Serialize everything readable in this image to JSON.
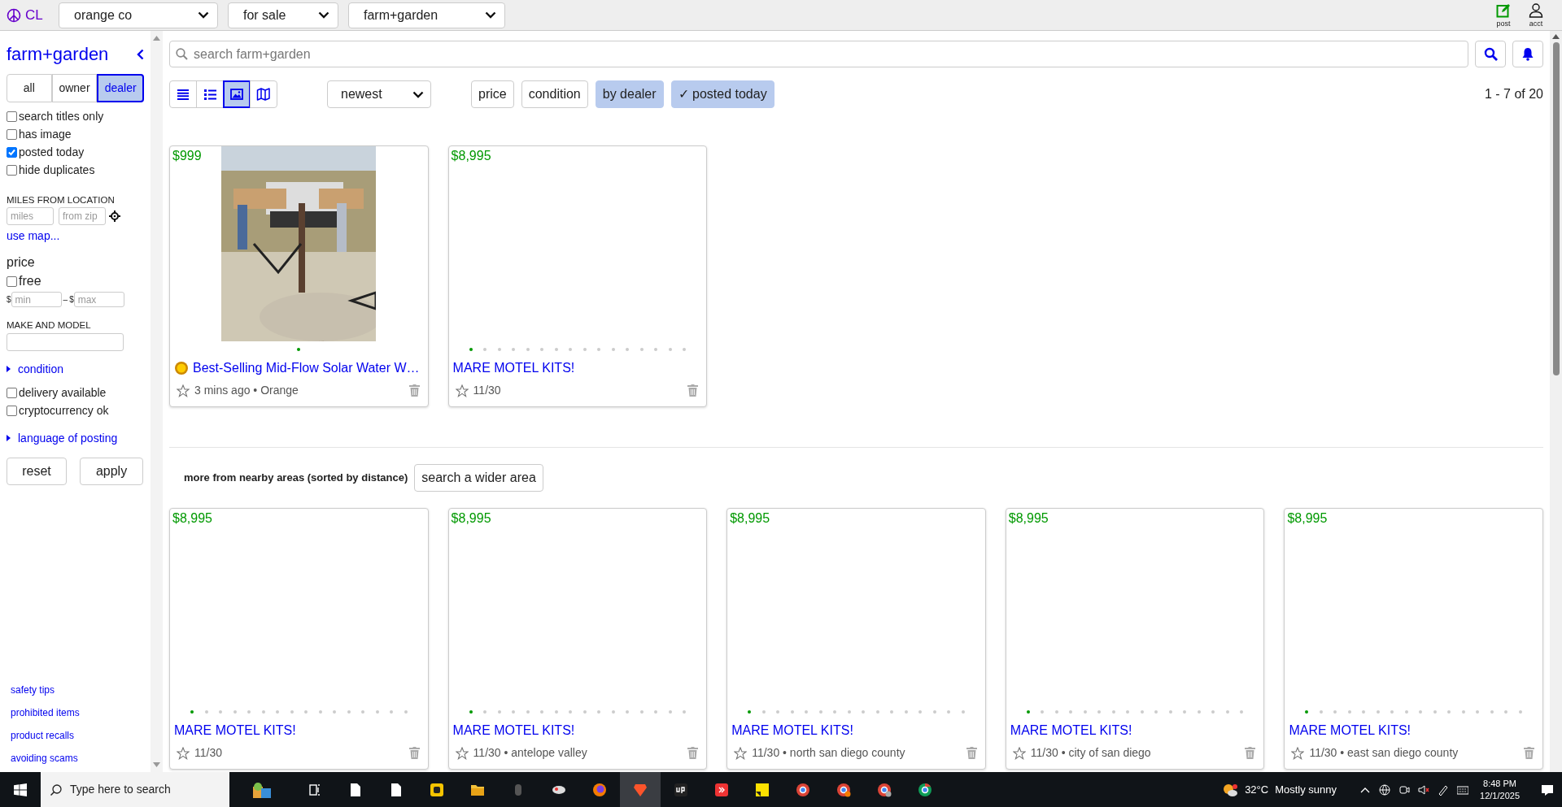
{
  "top_bar": {
    "logo": "CL",
    "selects": [
      "orange co",
      "for sale",
      "farm+garden"
    ],
    "actions": [
      {
        "kind": "post",
        "label": "post"
      },
      {
        "kind": "account",
        "label": "acct"
      }
    ]
  },
  "sidebar": {
    "title": "farm+garden",
    "seller_tabs": [
      {
        "label": "all",
        "selected": false
      },
      {
        "label": "owner",
        "selected": false
      },
      {
        "label": "dealer",
        "selected": true
      }
    ],
    "options": [
      {
        "label": "search titles only",
        "checked": false
      },
      {
        "label": "has image",
        "checked": false
      },
      {
        "label": "posted today",
        "checked": true
      },
      {
        "label": "hide duplicates",
        "checked": false
      }
    ],
    "location": {
      "heading": "MILES FROM LOCATION",
      "miles_placeholder": "miles",
      "zip_placeholder": "from zip",
      "map_link": "use map..."
    },
    "price": {
      "heading": "price",
      "free": {
        "label": "free",
        "checked": false
      },
      "min_prefix": "$",
      "min_placeholder": "min",
      "separator": "–",
      "max_prefix": "$",
      "max_placeholder": "max"
    },
    "make_model": {
      "heading": "MAKE AND MODEL"
    },
    "condition": {
      "label": "condition",
      "expanded": false
    },
    "more_options": [
      {
        "label": "delivery available",
        "checked": false
      },
      {
        "label": "cryptocurrency ok",
        "checked": false
      }
    ],
    "language": {
      "label": "language of posting",
      "expanded": false
    },
    "buttons": [
      "reset",
      "apply"
    ],
    "footer_links": [
      "safety tips",
      "prohibited items",
      "product recalls",
      "avoiding scams"
    ]
  },
  "main": {
    "search": {
      "placeholder": "search farm+garden"
    },
    "view_modes": [
      {
        "kind": "list",
        "selected": false
      },
      {
        "kind": "detail",
        "selected": false
      },
      {
        "kind": "gallery",
        "selected": true
      },
      {
        "kind": "map",
        "selected": false
      }
    ],
    "sort": "newest",
    "filters": [
      {
        "label": "price",
        "selected": false
      },
      {
        "label": "condition",
        "selected": false
      },
      {
        "label": "by dealer",
        "selected": true
      },
      {
        "label": "✓ posted today",
        "selected": true
      }
    ],
    "count": "1 - 7 of 20",
    "results": [
      {
        "price": "$999",
        "kind": "picture",
        "featured": true,
        "title": "Best-Selling Mid-Flow Solar Water W…",
        "meta": "3 mins ago • Orange",
        "photos": [
          {
            "selected": true
          }
        ]
      },
      {
        "price": "$8,995",
        "featured": false,
        "title": "MARE MOTEL KITS!",
        "meta": "11/30",
        "photos": [
          {
            "selected": true
          },
          {
            "selected": false
          },
          {
            "selected": false
          },
          {
            "selected": false
          },
          {
            "selected": false
          },
          {
            "selected": false
          },
          {
            "selected": false
          },
          {
            "selected": false
          },
          {
            "selected": false
          },
          {
            "selected": false
          },
          {
            "selected": false
          },
          {
            "selected": false
          },
          {
            "selected": false
          },
          {
            "selected": false
          },
          {
            "selected": false
          },
          {
            "selected": false
          }
        ]
      }
    ],
    "nearby": {
      "heading": "more from nearby areas (sorted by distance)",
      "button": "search a wider area",
      "results": [
        {
          "price": "$8,995",
          "featured": false,
          "title": "MARE MOTEL KITS!",
          "meta": "11/30",
          "photos": [
            {
              "selected": true
            },
            {
              "selected": false
            },
            {
              "selected": false
            },
            {
              "selected": false
            },
            {
              "selected": false
            },
            {
              "selected": false
            },
            {
              "selected": false
            },
            {
              "selected": false
            },
            {
              "selected": false
            },
            {
              "selected": false
            },
            {
              "selected": false
            },
            {
              "selected": false
            },
            {
              "selected": false
            },
            {
              "selected": false
            },
            {
              "selected": false
            },
            {
              "selected": false
            }
          ]
        },
        {
          "price": "$8,995",
          "featured": false,
          "title": "MARE MOTEL KITS!",
          "meta": "11/30 • antelope valley",
          "photos": [
            {
              "selected": true
            },
            {
              "selected": false
            },
            {
              "selected": false
            },
            {
              "selected": false
            },
            {
              "selected": false
            },
            {
              "selected": false
            },
            {
              "selected": false
            },
            {
              "selected": false
            },
            {
              "selected": false
            },
            {
              "selected": false
            },
            {
              "selected": false
            },
            {
              "selected": false
            },
            {
              "selected": false
            },
            {
              "selected": false
            },
            {
              "selected": false
            },
            {
              "selected": false
            }
          ]
        },
        {
          "price": "$8,995",
          "featured": false,
          "title": "MARE MOTEL KITS!",
          "meta": "11/30 • north san diego county",
          "photos": [
            {
              "selected": true
            },
            {
              "selected": false
            },
            {
              "selected": false
            },
            {
              "selected": false
            },
            {
              "selected": false
            },
            {
              "selected": false
            },
            {
              "selected": false
            },
            {
              "selected": false
            },
            {
              "selected": false
            },
            {
              "selected": false
            },
            {
              "selected": false
            },
            {
              "selected": false
            },
            {
              "selected": false
            },
            {
              "selected": false
            },
            {
              "selected": false
            },
            {
              "selected": false
            }
          ]
        },
        {
          "price": "$8,995",
          "featured": false,
          "title": "MARE MOTEL KITS!",
          "meta": "11/30 • city of san diego",
          "photos": [
            {
              "selected": true
            },
            {
              "selected": false
            },
            {
              "selected": false
            },
            {
              "selected": false
            },
            {
              "selected": false
            },
            {
              "selected": false
            },
            {
              "selected": false
            },
            {
              "selected": false
            },
            {
              "selected": false
            },
            {
              "selected": false
            },
            {
              "selected": false
            },
            {
              "selected": false
            },
            {
              "selected": false
            },
            {
              "selected": false
            },
            {
              "selected": false
            },
            {
              "selected": false
            }
          ]
        },
        {
          "price": "$8,995",
          "featured": false,
          "title": "MARE MOTEL KITS!",
          "meta": "11/30 • east san diego county",
          "photos": [
            {
              "selected": true
            },
            {
              "selected": false
            },
            {
              "selected": false
            },
            {
              "selected": false
            },
            {
              "selected": false
            },
            {
              "selected": false
            },
            {
              "selected": false
            },
            {
              "selected": false
            },
            {
              "selected": false
            },
            {
              "selected": false
            },
            {
              "selected": false
            },
            {
              "selected": false
            },
            {
              "selected": false
            },
            {
              "selected": false
            },
            {
              "selected": false
            },
            {
              "selected": false
            }
          ]
        }
      ]
    }
  },
  "taskbar": {
    "search_placeholder": "Type here to search",
    "temperature": "32°C",
    "weather": "Mostly sunny",
    "time": "8:48 PM",
    "date": "12/1/2025"
  }
}
